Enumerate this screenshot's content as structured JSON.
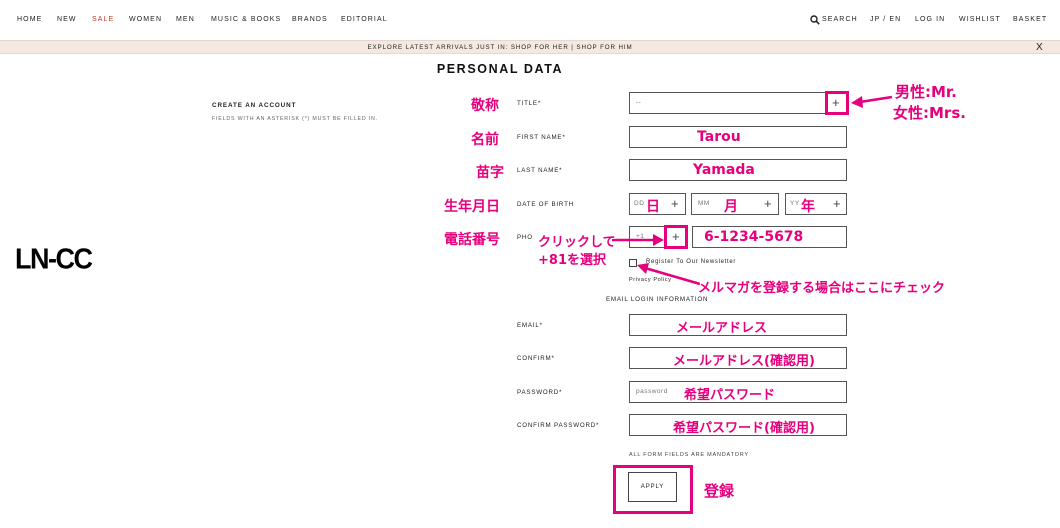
{
  "nav": {
    "items": [
      "HOME",
      "NEW",
      "SALE",
      "WOMEN",
      "MEN",
      "MUSIC & BOOKS",
      "BRANDS",
      "EDITORIAL"
    ],
    "right": [
      "SEARCH",
      "JP / EN",
      "LOG IN",
      "WISHLIST",
      "BASKET"
    ]
  },
  "promo": {
    "text": "EXPLORE LATEST ARRIVALS JUST IN: SHOP FOR HER | SHOP FOR HIM",
    "close": "X"
  },
  "page_title": "PERSONAL DATA",
  "create": {
    "title": "CREATE AN ACCOUNT",
    "note": "FIELDS WITH AN ASTERISK (*) MUST BE FILLED IN."
  },
  "logo": "LN-CC",
  "form": {
    "title_label": "TITLE*",
    "title_value": "--",
    "first_name_label": "FIRST NAME*",
    "last_name_label": "LAST NAME*",
    "dob_label": "DATE OF BIRTH",
    "dob_dd": "DD",
    "dob_mm": "MM",
    "dob_yy": "YY",
    "phone_label": "PHO",
    "phone_code": "+1",
    "newsletter": "Register To Our Newsletter",
    "privacy": "Privacy Policy",
    "email_head": "EMAIL LOGIN INFORMATION",
    "email_label": "EMAIL*",
    "confirm_label": "CONFIRM*",
    "password_label": "PASSWORD*",
    "password_placeholder": "password",
    "confirm_password_label": "CONFIRM PASSWORD*",
    "mandatory": "ALL FORM FIELDS ARE MANDATORY",
    "apply": "APPLY"
  },
  "annotations": {
    "title_jp": "敬称",
    "first_jp": "名前",
    "last_jp": "苗字",
    "dob_jp": "生年月日",
    "phone_jp": "電話番号",
    "mr": "男性:Mr.",
    "mrs": "女性:Mrs.",
    "tarou": "Tarou",
    "yamada": "Yamada",
    "day": "日",
    "month": "月",
    "year": "年",
    "click1": "クリックして",
    "click2": "+81を選択",
    "phone_num": "6-1234-5678",
    "newsletter_note": "メルマガを登録する場合はここにチェック",
    "email_addr": "メールアドレス",
    "email_confirm": "メールアドレス(確認用)",
    "password": "希望パスワード",
    "password_confirm": "希望パスワード(確認用)",
    "register": "登録"
  },
  "colors": {
    "accent": "#e6007e",
    "sale": "#c0392b",
    "promo_bg": "#f4e8e0"
  }
}
